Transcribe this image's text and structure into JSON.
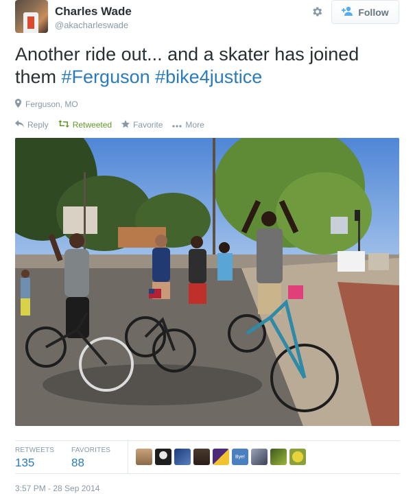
{
  "user": {
    "display_name": "Charles Wade",
    "screen_name": "@akacharleswade"
  },
  "follow_button": {
    "label": "Follow",
    "icon": "follow-person-icon"
  },
  "settings_icon": "gear-icon",
  "tweet": {
    "text_main": "Another ride out... and a skater has joined them ",
    "hashtags": [
      "#Ferguson",
      "#bike4justice"
    ],
    "location": "Ferguson, MO"
  },
  "actions": {
    "reply": "Reply",
    "retweet": "Retweeted",
    "favorite": "Favorite",
    "more": "More"
  },
  "colors": {
    "link": "#2b7bb9",
    "retweeted": "#609928",
    "muted": "#8899a6",
    "text": "#292f33"
  },
  "stats": {
    "retweets_label": "RETWEETS",
    "retweets_value": "135",
    "favorites_label": "FAVORITES",
    "favorites_value": "88"
  },
  "favoriters_avatar_bye": "Bye!",
  "timestamp": "3:57 PM - 28 Sep 2014"
}
